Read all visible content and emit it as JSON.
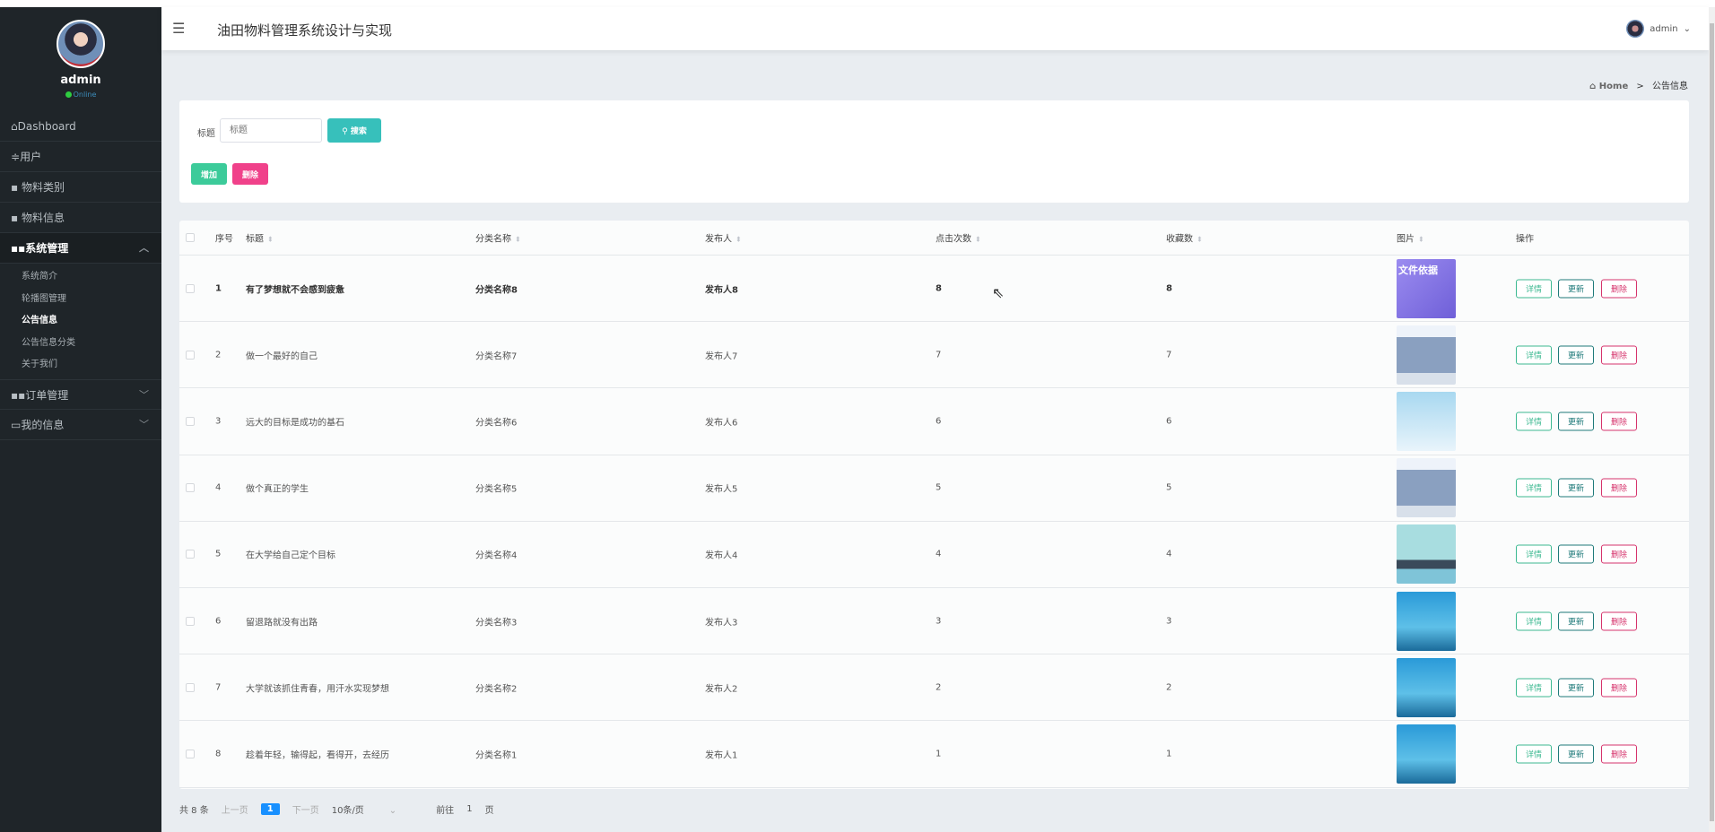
{
  "app_title": "油田物料管理系统设计与实现",
  "user": {
    "name": "admin",
    "status": "Online"
  },
  "sidebar": {
    "items": [
      {
        "label": "Dashboard",
        "icon": "home-icon"
      },
      {
        "label": "用户",
        "icon": "sliders-icon"
      },
      {
        "label": "物料类别",
        "icon": "box-icon"
      },
      {
        "label": "物料信息",
        "icon": "box-icon"
      }
    ],
    "system": {
      "label": "系统管理",
      "sub": [
        "系统简介",
        "轮播图管理",
        "公告信息",
        "公告信息分类",
        "关于我们"
      ]
    },
    "orders": "订单管理",
    "mine": "我的信息"
  },
  "breadcrumb": {
    "home": "Home",
    "sep": ">",
    "current": "公告信息"
  },
  "search": {
    "label": "标题",
    "placeholder": "标题",
    "button": "搜索"
  },
  "actions": {
    "add": "增加",
    "delete": "删除"
  },
  "table": {
    "headers": [
      "序号",
      "标题",
      "分类名称",
      "发布人",
      "点击次数",
      "收藏数",
      "图片",
      "操作"
    ],
    "row_buttons": {
      "detail": "详情",
      "update": "更新",
      "delete": "删除"
    },
    "rows": [
      {
        "no": "1",
        "title": "有了梦想就不会感到疲惫",
        "category": "分类名称8",
        "publisher": "发布人8",
        "clicks": "8",
        "favs": "8",
        "img_text": "文件依据"
      },
      {
        "no": "2",
        "title": "做一个最好的自己",
        "category": "分类名称7",
        "publisher": "发布人7",
        "clicks": "7",
        "favs": "7",
        "img_text": ""
      },
      {
        "no": "3",
        "title": "远大的目标是成功的基石",
        "category": "分类名称6",
        "publisher": "发布人6",
        "clicks": "6",
        "favs": "6",
        "img_text": ""
      },
      {
        "no": "4",
        "title": "做个真正的学生",
        "category": "分类名称5",
        "publisher": "发布人5",
        "clicks": "5",
        "favs": "5",
        "img_text": ""
      },
      {
        "no": "5",
        "title": "在大学给自己定个目标",
        "category": "分类名称4",
        "publisher": "发布人4",
        "clicks": "4",
        "favs": "4",
        "img_text": ""
      },
      {
        "no": "6",
        "title": "留退路就没有出路",
        "category": "分类名称3",
        "publisher": "发布人3",
        "clicks": "3",
        "favs": "3",
        "img_text": ""
      },
      {
        "no": "7",
        "title": "大学就该抓住青春，用汗水实现梦想",
        "category": "分类名称2",
        "publisher": "发布人2",
        "clicks": "2",
        "favs": "2",
        "img_text": ""
      },
      {
        "no": "8",
        "title": "趁着年轻，输得起，看得开，去经历",
        "category": "分类名称1",
        "publisher": "发布人1",
        "clicks": "1",
        "favs": "1",
        "img_text": ""
      }
    ]
  },
  "pagination": {
    "total": "共 8 条",
    "prev": "上一页",
    "current": "1",
    "next": "下一页",
    "page_size": "10条/页",
    "goto": "前往",
    "goto_value": "1",
    "page_unit": "页"
  }
}
